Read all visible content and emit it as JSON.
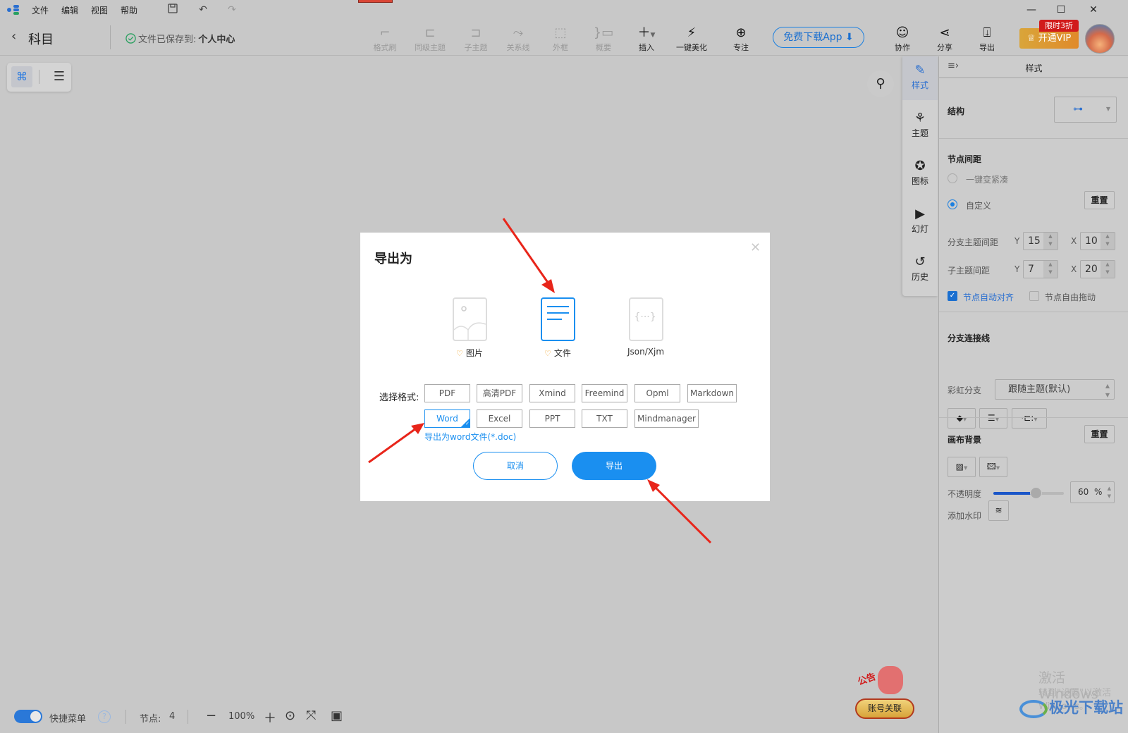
{
  "menu": {
    "items": [
      "文件",
      "编辑",
      "视图",
      "帮助"
    ]
  },
  "window_controls": {
    "minimize": "—",
    "maximize": "☐",
    "close": "✕"
  },
  "header": {
    "back_icon": "chevron-left-icon",
    "doc_title": "科目",
    "save_status": "文件已保存到:",
    "save_location": "个人中心"
  },
  "toolbar": {
    "items": [
      {
        "label": "格式刷",
        "icon": "format-brush-icon",
        "enabled": false
      },
      {
        "label": "同级主题",
        "icon": "sibling-topic-icon",
        "enabled": false
      },
      {
        "label": "子主题",
        "icon": "subtopic-icon",
        "enabled": false
      },
      {
        "label": "关系线",
        "icon": "relation-line-icon",
        "enabled": false
      },
      {
        "label": "外框",
        "icon": "boundary-icon",
        "enabled": false
      },
      {
        "label": "概要",
        "icon": "summary-icon",
        "enabled": false
      },
      {
        "label": "插入",
        "icon": "plus-icon",
        "enabled": true
      },
      {
        "label": "一键美化",
        "icon": "magic-wand-icon",
        "enabled": true
      },
      {
        "label": "专注",
        "icon": "focus-icon",
        "enabled": true
      }
    ],
    "download_app": "免费下载App",
    "right_items": [
      {
        "label": "协作",
        "icon": "collaborate-icon"
      },
      {
        "label": "分享",
        "icon": "share-icon"
      },
      {
        "label": "导出",
        "icon": "export-icon"
      }
    ],
    "vip_label": "开通VIP",
    "vip_badge": "限时3折"
  },
  "view_switch": {
    "mindmap": "mindmap-view-icon",
    "outline": "outline-view-icon"
  },
  "side_tabs": [
    {
      "label": "样式",
      "icon": "style-icon",
      "active": true
    },
    {
      "label": "主题",
      "icon": "theme-icon",
      "active": false
    },
    {
      "label": "图标",
      "icon": "sticker-icon",
      "active": false
    },
    {
      "label": "幻灯",
      "icon": "slides-icon",
      "active": false
    },
    {
      "label": "历史",
      "icon": "history-icon",
      "active": false
    }
  ],
  "panel": {
    "title": "样式",
    "structure_label": "结构",
    "spacing_label": "节点间距",
    "compact_option": "一键变紧凑",
    "custom_option": "自定义",
    "reset": "重置",
    "branch_spacing_label": "分支主题间距",
    "branch_y": "15",
    "branch_x": "10",
    "sub_spacing_label": "子主题间距",
    "sub_y": "7",
    "sub_x": "20",
    "y_label": "Y",
    "x_label": "X",
    "auto_align": "节点自动对齐",
    "auto_align_checked": true,
    "free_drag": "节点自由拖动",
    "free_drag_checked": false,
    "connector_label": "分支连接线",
    "rainbow_label": "彩虹分支",
    "rainbow_value": "跟随主题(默认)",
    "canvas_bg_label": "画布背景",
    "opacity_label": "不透明度",
    "opacity_value": "60",
    "opacity_unit": "%",
    "opacity_fraction": 0.6,
    "watermark_label": "添加水印"
  },
  "dialog": {
    "title": "导出为",
    "types": [
      {
        "label": "图片",
        "vip": true,
        "selected": false
      },
      {
        "label": "文件",
        "vip": true,
        "selected": true
      },
      {
        "label": "Json/Xjm",
        "vip": false,
        "selected": false
      }
    ],
    "select_label": "选择格式:",
    "formats_row1": [
      "PDF",
      "高清PDF",
      "Xmind",
      "Freemind",
      "Opml",
      "Markdown"
    ],
    "formats_row2": [
      "Word",
      "Excel",
      "PPT",
      "TXT",
      "Mindmanager"
    ],
    "selected_format": "Word",
    "hint": "导出为word文件(*.doc)",
    "cancel": "取消",
    "export": "导出"
  },
  "bottom": {
    "quick_menu": "快捷菜单",
    "quick_menu_on": true,
    "help": "?",
    "nodes_label": "节点:",
    "nodes_count": "4",
    "zoom": "100%"
  },
  "notice": {
    "badge": "公告",
    "button": "账号关联"
  },
  "watermark": {
    "line1": "激活 Windows",
    "line2": "转到\"设置\"以激活 Windows。",
    "site": "极光下载站"
  },
  "colors": {
    "accent": "#1a8ff0",
    "vip": "#e0a030",
    "arrow": "#e8251a"
  }
}
